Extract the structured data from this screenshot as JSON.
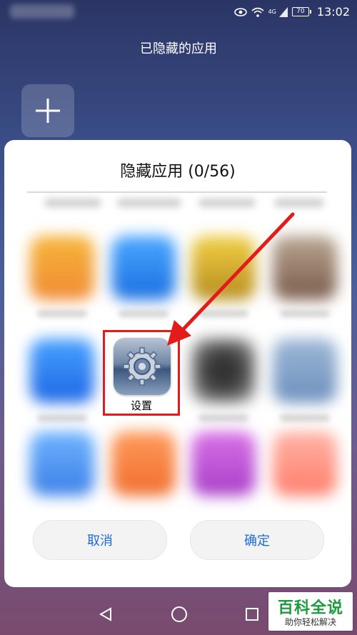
{
  "status_bar": {
    "network": "4G",
    "battery": "70",
    "time": "13:02",
    "icons": [
      "eye-comfort-icon",
      "wifi-icon",
      "signal-icon",
      "battery-icon"
    ]
  },
  "header": {
    "title": "已隐藏的应用"
  },
  "add_tile": {
    "icon": "plus-icon"
  },
  "dialog": {
    "title": "隐藏应用 (0/56)",
    "highlighted_app": {
      "label": "设置",
      "icon": "settings-gear-icon"
    },
    "buttons": {
      "cancel": "取消",
      "confirm": "确定"
    },
    "annotation_color": "#e31b1b"
  },
  "nav": {
    "icons": [
      "back-icon",
      "home-icon",
      "recents-icon"
    ]
  },
  "watermark": {
    "title": "百科全说",
    "subtitle": "助你轻松解决"
  },
  "colors": {
    "accent": "#1f6bd6",
    "watermark_green": "#1c9c3c"
  }
}
